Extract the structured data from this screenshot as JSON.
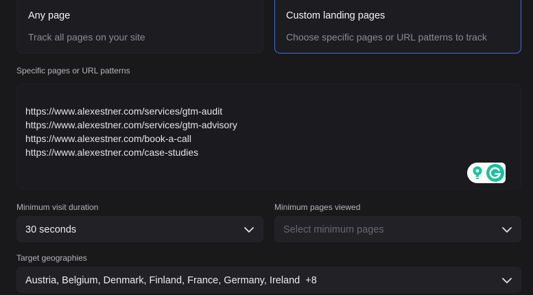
{
  "landing_options": {
    "any": {
      "title": "Any page",
      "description": "Track all pages on your site"
    },
    "custom": {
      "title": "Custom landing pages",
      "description": "Choose specific pages or URL patterns to track"
    }
  },
  "url_patterns": {
    "label": "Specific pages or URL patterns",
    "lines": [
      "https://www.alexestner.com/services/gtm-audit",
      "https://www.alexestner.com/services/gtm-advisory",
      "https://www.alexestner.com/book-a-call",
      "https://www.alexestner.com/case-studies"
    ]
  },
  "min_visit_duration": {
    "label": "Minimum visit duration",
    "value": "30 seconds"
  },
  "min_pages_viewed": {
    "label": "Minimum pages viewed",
    "placeholder": "Select minimum pages"
  },
  "target_geographies": {
    "label": "Target geographies",
    "value": "Austria, Belgium, Denmark, Finland, France, Germany, Ireland  +8"
  },
  "colors": {
    "selected_border": "#3b6fe0",
    "grammarly_green": "#15c39a"
  },
  "icons": {
    "dropdown": "chevron-down-icon",
    "grammarly": "grammarly-icon"
  }
}
